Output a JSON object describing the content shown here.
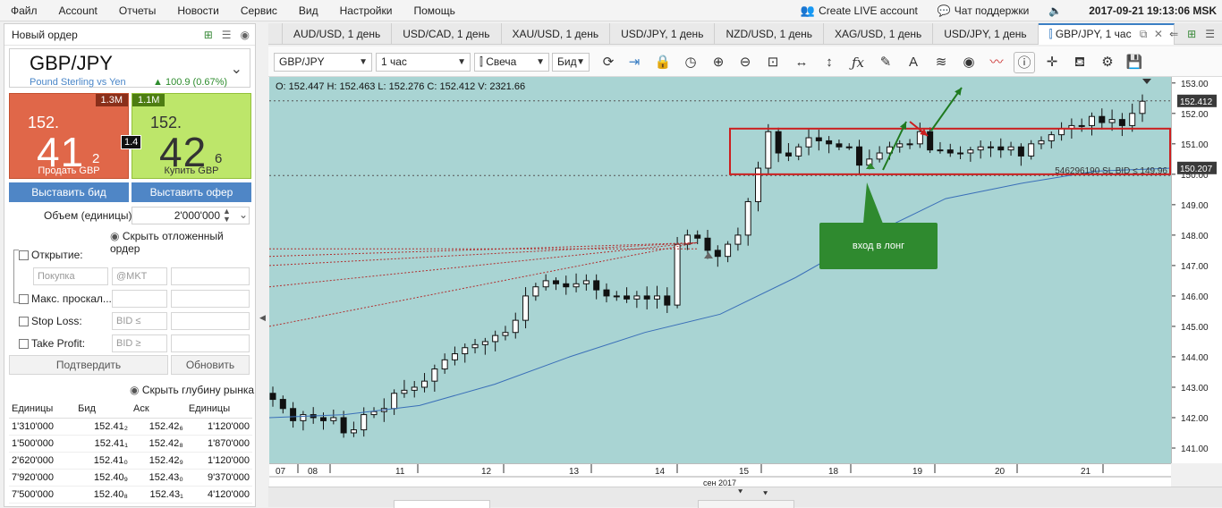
{
  "menu": {
    "items": [
      "Файл",
      "Account",
      "Отчеты",
      "Новости",
      "Сервис",
      "Вид",
      "Настройки",
      "Помощь"
    ],
    "live_account": "Create LIVE account",
    "support": "Чат поддержки",
    "datetime": "2017-09-21 19:13:06 MSK"
  },
  "order_panel": {
    "title": "Новый ордер",
    "symbol": "GBP/JPY",
    "symbol_full": "Pound Sterling vs Yen",
    "change": "100.9 (0.67%)",
    "sell": {
      "volume": "1.3M",
      "small": "152.",
      "big": "41",
      "sup": "2",
      "label": "Продать GBP"
    },
    "buy": {
      "volume": "1.1M",
      "small": "152.",
      "big": "42",
      "sup": "6",
      "label": "Купить GBP"
    },
    "spread": "1.4",
    "place_bid": "Выставить бид",
    "place_offer": "Выставить офер",
    "volume_label": "Объем (единицы):",
    "volume_value": "2'000'000",
    "hide_pending": "Скрыть отложенный ордер",
    "open_label": "Открытие:",
    "open_type": "Покупка",
    "open_price": "@MKT",
    "max_slippage": "Макс. проскал...",
    "stop_loss": "Stop Loss:",
    "stop_loss_cond": "BID ≤",
    "take_profit": "Take Profit:",
    "take_profit_cond": "BID ≥",
    "confirm": "Подтвердить",
    "update": "Обновить",
    "hide_depth": "Скрыть глубину рынка"
  },
  "depth": {
    "headers": [
      "Единицы",
      "Бид",
      "Аск",
      "Единицы"
    ],
    "rows": [
      [
        "1'310'000",
        "152.41₂",
        "152.42₆",
        "1'120'000"
      ],
      [
        "1'500'000",
        "152.41₁",
        "152.42₈",
        "1'870'000"
      ],
      [
        "2'620'000",
        "152.41₀",
        "152.42₉",
        "1'120'000"
      ],
      [
        "7'920'000",
        "152.40₉",
        "152.43₀",
        "9'370'000"
      ],
      [
        "7'500'000",
        "152.40₈",
        "152.43₁",
        "4'120'000"
      ]
    ]
  },
  "tabs": [
    "AUD/USD, 1 день",
    "USD/CAD, 1 день",
    "XAU/USD, 1 день",
    "USD/JPY, 1 день",
    "NZD/USD, 1 день",
    "XAG/USD, 1 день",
    "USD/JPY, 1 день",
    "GBP/JPY, 1 час"
  ],
  "toolbar": {
    "instrument": "GBP/JPY",
    "period": "1 час",
    "chart_type": "Свеча",
    "side": "Бид"
  },
  "chart_info": {
    "ohlc": "O: 152.447  H: 152.463  L: 152.276  C: 152.412  V: 2321.66",
    "current_price": "152.412",
    "level_price": "150.207",
    "sl_label": "546296190 SL BID ≤ 149.96",
    "callout": "вход в лонг",
    "month_label": "сен 2017"
  },
  "chart_data": {
    "type": "candlestick",
    "y_ticks": [
      "153.00",
      "152.00",
      "151.00",
      "150.00",
      "149.00",
      "148.00",
      "147.00",
      "146.00",
      "145.00",
      "144.00",
      "143.00",
      "142.00",
      "141.00"
    ],
    "ylim": [
      140.5,
      153.2
    ],
    "x_ticks": [
      "07",
      "08",
      "11",
      "12",
      "13",
      "14",
      "15",
      "18",
      "19",
      "20",
      "21"
    ],
    "close_path": [
      142.6,
      142.3,
      141.9,
      142.1,
      142.0,
      141.9,
      142.0,
      141.5,
      141.6,
      142.1,
      142.2,
      142.3,
      142.8,
      142.9,
      143.0,
      143.2,
      143.6,
      143.9,
      144.1,
      144.3,
      144.4,
      144.5,
      144.7,
      144.8,
      145.2,
      146.0,
      146.3,
      146.5,
      146.4,
      146.3,
      146.4,
      146.5,
      146.2,
      146.0,
      146.0,
      145.9,
      146.0,
      145.9,
      146.0,
      145.7,
      147.7,
      148.0,
      147.9,
      147.5,
      147.3,
      147.7,
      148.0,
      149.1,
      150.2,
      151.4,
      150.7,
      150.6,
      150.9,
      151.2,
      151.1,
      151.0,
      150.9,
      150.9,
      150.3,
      150.5,
      150.7,
      150.9,
      151.0,
      151.0,
      151.4,
      150.8,
      150.8,
      150.7,
      150.7,
      150.8,
      150.9,
      150.9,
      150.8,
      150.9,
      150.6,
      151.0,
      151.1,
      151.3,
      151.5,
      151.6,
      151.6,
      151.9,
      151.7,
      151.8,
      151.6,
      152.0,
      152.4
    ],
    "ma_path": [
      142.0,
      142.1,
      142.4,
      143.1,
      144.0,
      144.8,
      145.4,
      146.6,
      148.0,
      149.2,
      149.7,
      150.1,
      150.2
    ]
  }
}
